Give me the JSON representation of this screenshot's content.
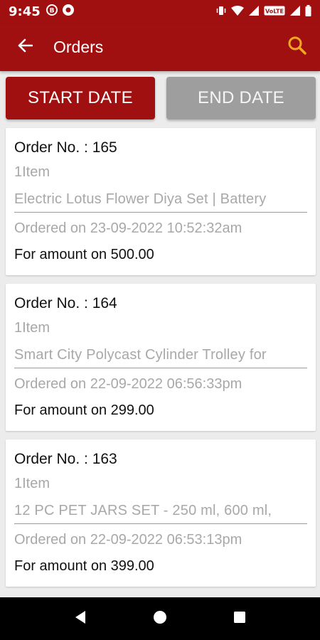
{
  "status_bar": {
    "time": "9:45",
    "left_icons": [
      "message-icon",
      "circle-app-icon"
    ],
    "right_icons": [
      "vibrate-icon",
      "wifi-icon",
      "signal-icon",
      "volte-icon",
      "signal-icon-2",
      "battery-icon"
    ],
    "volte_label": "VoLTE"
  },
  "app_bar": {
    "title": "Orders",
    "back_icon": "back-arrow-icon",
    "search_icon": "search-icon"
  },
  "date_filters": {
    "start_label": "START DATE",
    "end_label": "END DATE"
  },
  "orders": [
    {
      "number": "Order No. : 165",
      "items": "1Item",
      "product": "Electric Lotus Flower Diya Set | Battery",
      "ordered_on": "Ordered on 23-09-2022 10:52:32am",
      "amount": "For amount on 500.00"
    },
    {
      "number": "Order No. : 164",
      "items": "1Item",
      "product": "Smart City Polycast Cylinder Trolley for",
      "ordered_on": "Ordered on 22-09-2022 06:56:33pm",
      "amount": "For amount on 299.00"
    },
    {
      "number": "Order No. : 163",
      "items": "1Item",
      "product": "12 PC PET JARS SET - 250 ml, 600 ml,",
      "ordered_on": "Ordered on 22-09-2022 06:53:13pm",
      "amount": "For amount on 399.00"
    }
  ],
  "nav_bar": {
    "buttons": [
      "back-triangle-icon",
      "home-circle-icon",
      "recents-square-icon"
    ]
  },
  "colors": {
    "primary": "#a11010",
    "search_accent": "#f5a623",
    "disabled_button": "#9e9e9e"
  }
}
